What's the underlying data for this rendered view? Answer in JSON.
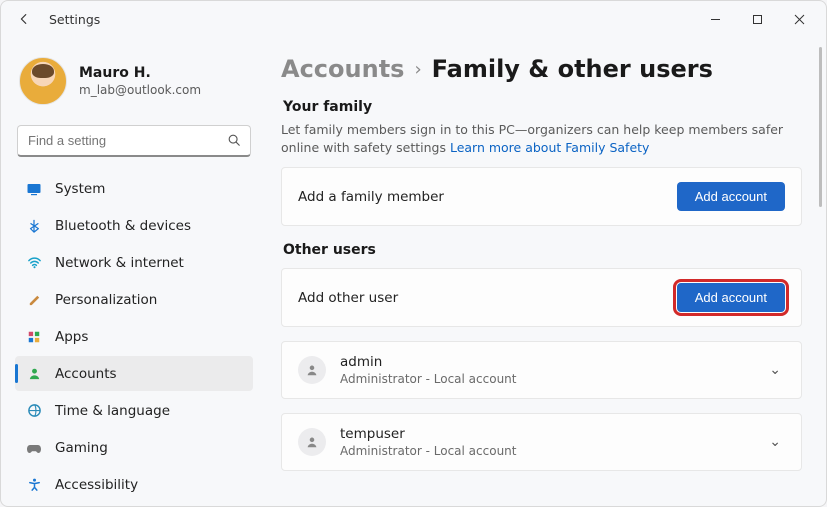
{
  "window": {
    "title": "Settings"
  },
  "profile": {
    "name": "Mauro H.",
    "email": "m_lab@outlook.com"
  },
  "search": {
    "placeholder": "Find a setting"
  },
  "sidebar": {
    "items": [
      {
        "icon": "system-icon",
        "label": "System"
      },
      {
        "icon": "bluetooth-icon",
        "label": "Bluetooth & devices"
      },
      {
        "icon": "network-icon",
        "label": "Network & internet"
      },
      {
        "icon": "personalization-icon",
        "label": "Personalization"
      },
      {
        "icon": "apps-icon",
        "label": "Apps"
      },
      {
        "icon": "accounts-icon",
        "label": "Accounts"
      },
      {
        "icon": "time-icon",
        "label": "Time & language"
      },
      {
        "icon": "gaming-icon",
        "label": "Gaming"
      },
      {
        "icon": "accessibility-icon",
        "label": "Accessibility"
      }
    ],
    "active_index": 5
  },
  "breadcrumb": {
    "parent": "Accounts",
    "current": "Family & other users"
  },
  "family": {
    "section_title": "Your family",
    "description_prefix": "Let family members sign in to this PC—organizers can help keep members safer online with safety settings  ",
    "learn_more": "Learn more about Family Safety",
    "add_label": "Add a family member",
    "add_button": "Add account"
  },
  "other": {
    "section_title": "Other users",
    "add_label": "Add other user",
    "add_button": "Add account",
    "users": [
      {
        "name": "admin",
        "role": "Administrator - Local account"
      },
      {
        "name": "tempuser",
        "role": "Administrator - Local account"
      }
    ]
  }
}
